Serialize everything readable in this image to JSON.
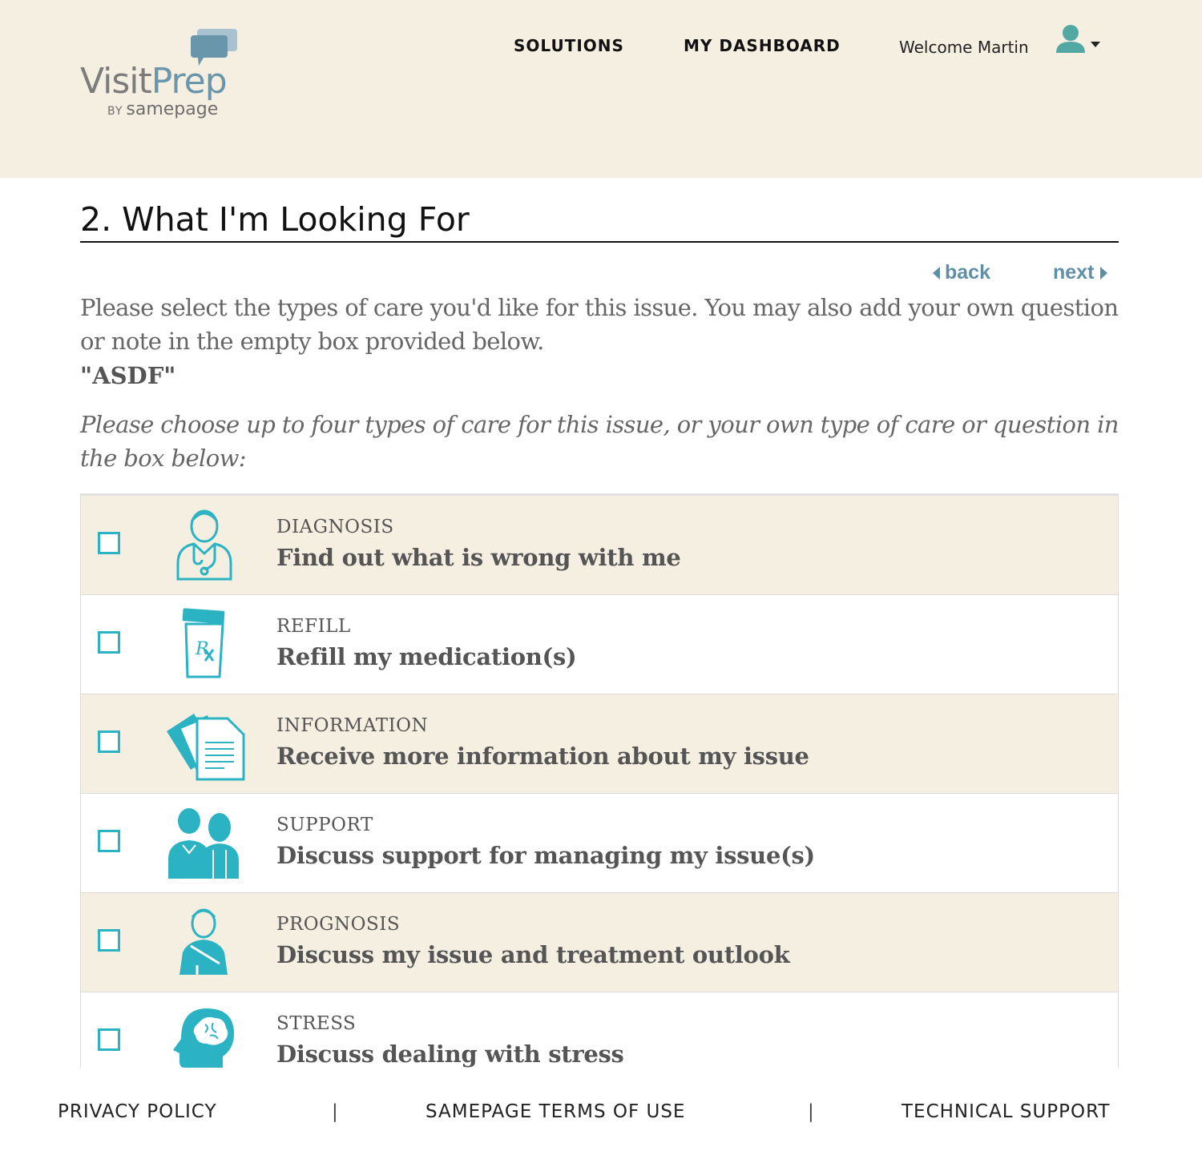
{
  "brand": {
    "name_part1": "Visit",
    "name_part2": "Prep",
    "by": "BY",
    "company": "samepage"
  },
  "nav": {
    "solutions": "SOLUTIONS",
    "dashboard": "MY DASHBOARD",
    "welcome": "Welcome Martin"
  },
  "page": {
    "title": "2. What I'm Looking For",
    "back_label": "back",
    "next_label": "next",
    "intro": "Please select the types of care you'd like for this issue. You may also add your own question or note in the empty box provided below.",
    "issue_name": "\"ASDF\"",
    "choose_prompt": "Please choose up to four types of care for this issue, or your own type of care or question in the box below:"
  },
  "care_options": [
    {
      "type": "DIAGNOSIS",
      "description": "Find out what is wrong with me",
      "icon": "doctor-icon",
      "checked": false
    },
    {
      "type": "REFILL",
      "description": "Refill my medication(s)",
      "icon": "prescription-bottle-icon",
      "checked": false
    },
    {
      "type": "INFORMATION",
      "description": "Receive more information about my issue",
      "icon": "documents-icon",
      "checked": false
    },
    {
      "type": "SUPPORT",
      "description": "Discuss support for managing my issue(s)",
      "icon": "people-support-icon",
      "checked": false
    },
    {
      "type": "PROGNOSIS",
      "description": "Discuss my issue and treatment outlook",
      "icon": "patient-sling-icon",
      "checked": false
    },
    {
      "type": "STRESS",
      "description": "Discuss dealing with stress",
      "icon": "head-brain-icon",
      "checked": false
    }
  ],
  "footer": {
    "privacy": "PRIVACY POLICY",
    "terms": "SAMEPAGE TERMS OF USE",
    "support": "TECHNICAL SUPPORT",
    "separator": "|"
  },
  "colors": {
    "header_bg": "#f5efe1",
    "accent_teal": "#2bb3c4",
    "link_blue": "#5f8fa6",
    "row_shade": "#f5efe1"
  }
}
